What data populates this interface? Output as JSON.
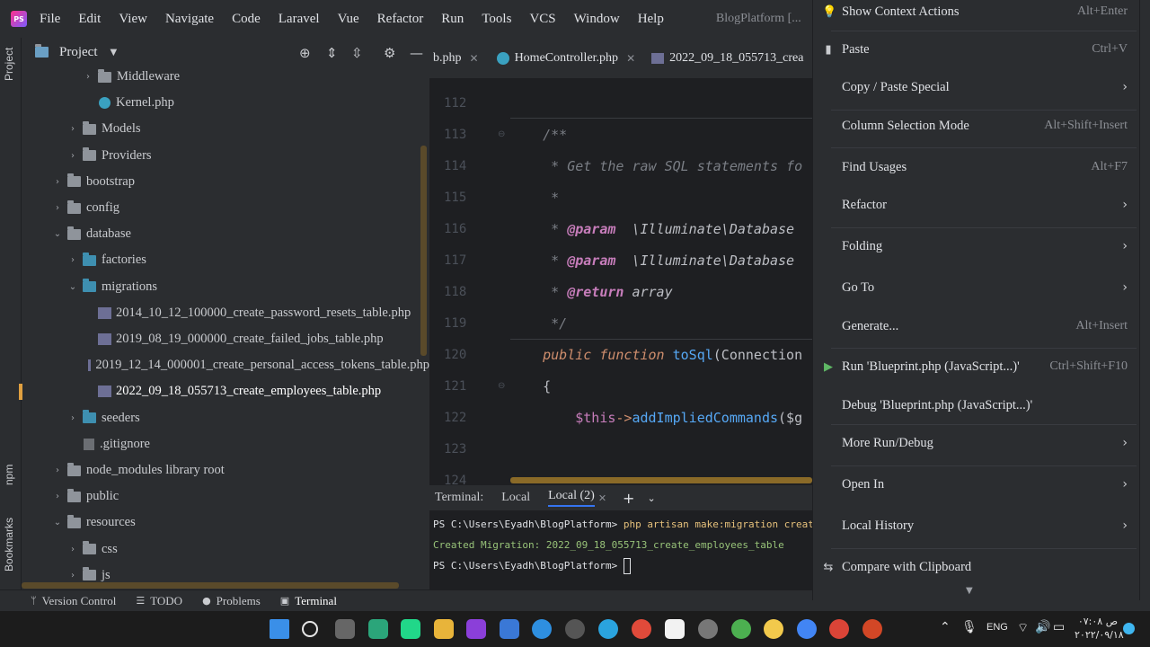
{
  "menubar": {
    "logo": "PS",
    "items": [
      "File",
      "Edit",
      "View",
      "Navigate",
      "Code",
      "Laravel",
      "Vue",
      "Refactor",
      "Run",
      "Tools",
      "VCS",
      "Window",
      "Help"
    ],
    "window_title": "BlogPlatform [..."
  },
  "left_strip": {
    "project": "Project",
    "npm": "npm",
    "bookmarks": "Bookmarks"
  },
  "project": {
    "title": "Project",
    "tree": [
      {
        "label": "Middleware",
        "depth": 3,
        "kind": "folder",
        "chevron": "›"
      },
      {
        "label": "Kernel.php",
        "depth": 3,
        "kind": "class"
      },
      {
        "label": "Models",
        "depth": 2,
        "kind": "folder",
        "chevron": "›"
      },
      {
        "label": "Providers",
        "depth": 2,
        "kind": "folder",
        "chevron": "›"
      },
      {
        "label": "bootstrap",
        "depth": 1,
        "kind": "folder",
        "chevron": "›"
      },
      {
        "label": "config",
        "depth": 1,
        "kind": "folder",
        "chevron": "›"
      },
      {
        "label": "database",
        "depth": 1,
        "kind": "folder",
        "chevron": "⌄"
      },
      {
        "label": "factories",
        "depth": 2,
        "kind": "folder-blue",
        "chevron": "›"
      },
      {
        "label": "migrations",
        "depth": 2,
        "kind": "folder-blue",
        "chevron": "⌄"
      },
      {
        "label": "2014_10_12_100000_create_password_resets_table.php",
        "depth": 3,
        "kind": "php"
      },
      {
        "label": "2019_08_19_000000_create_failed_jobs_table.php",
        "depth": 3,
        "kind": "php"
      },
      {
        "label": "2019_12_14_000001_create_personal_access_tokens_table.php",
        "depth": 3,
        "kind": "php"
      },
      {
        "label": "2022_09_18_055713_create_employees_table.php",
        "depth": 3,
        "kind": "php",
        "selected": true
      },
      {
        "label": "seeders",
        "depth": 2,
        "kind": "folder-blue",
        "chevron": "›"
      },
      {
        "label": ".gitignore",
        "depth": 2,
        "kind": "git"
      },
      {
        "label": "node_modules  library root",
        "depth": 1,
        "kind": "folder",
        "chevron": "›"
      },
      {
        "label": "public",
        "depth": 1,
        "kind": "folder",
        "chevron": "›"
      },
      {
        "label": "resources",
        "depth": 1,
        "kind": "folder",
        "chevron": "⌄"
      },
      {
        "label": "css",
        "depth": 2,
        "kind": "folder",
        "chevron": "›"
      },
      {
        "label": "js",
        "depth": 2,
        "kind": "folder",
        "chevron": "›"
      }
    ]
  },
  "editor": {
    "tabs": [
      {
        "label": "b.php",
        "icon": "none"
      },
      {
        "label": "HomeController.php",
        "icon": "class"
      },
      {
        "label": "2022_09_18_055713_crea",
        "icon": "php"
      }
    ],
    "lines": [
      {
        "n": "112",
        "tokens": []
      },
      {
        "n": "113",
        "tokens": [
          {
            "t": "    /**",
            "c": "cm"
          }
        ]
      },
      {
        "n": "114",
        "tokens": [
          {
            "t": "     * Get the raw SQL statements fo",
            "c": "cm"
          }
        ]
      },
      {
        "n": "115",
        "tokens": [
          {
            "t": "     *",
            "c": "cm"
          }
        ]
      },
      {
        "n": "116",
        "tokens": [
          {
            "t": "     * ",
            "c": "cm"
          },
          {
            "t": "@param",
            "c": "tag"
          },
          {
            "t": "  \\Illuminate\\Database",
            "c": "cm-plain"
          }
        ]
      },
      {
        "n": "117",
        "tokens": [
          {
            "t": "     * ",
            "c": "cm"
          },
          {
            "t": "@param",
            "c": "tag"
          },
          {
            "t": "  \\Illuminate\\Database",
            "c": "cm-plain"
          }
        ]
      },
      {
        "n": "118",
        "tokens": [
          {
            "t": "     * ",
            "c": "cm"
          },
          {
            "t": "@return",
            "c": "tag"
          },
          {
            "t": " array",
            "c": "cm-plain"
          }
        ]
      },
      {
        "n": "119",
        "tokens": [
          {
            "t": "     */",
            "c": "cm"
          }
        ]
      },
      {
        "n": "120",
        "tokens": [
          {
            "t": "    ",
            "c": "plain"
          },
          {
            "t": "public function",
            "c": "kw"
          },
          {
            "t": " ",
            "c": "plain"
          },
          {
            "t": "toSql",
            "c": "fn"
          },
          {
            "t": "(Connection",
            "c": "plain"
          }
        ]
      },
      {
        "n": "121",
        "tokens": [
          {
            "t": "    {",
            "c": "plain"
          }
        ]
      },
      {
        "n": "122",
        "tokens": [
          {
            "t": "        ",
            "c": "plain"
          },
          {
            "t": "$this",
            "c": "var"
          },
          {
            "t": "->",
            "c": "kw2"
          },
          {
            "t": "addImpliedCommands",
            "c": "fn"
          },
          {
            "t": "($g",
            "c": "plain"
          }
        ]
      },
      {
        "n": "123",
        "tokens": []
      },
      {
        "n": "124",
        "tokens": []
      }
    ]
  },
  "terminal": {
    "label": "Terminal:",
    "tabs": [
      "Local",
      "Local (2)"
    ],
    "prompt": "PS C:\\Users\\Eyadh\\BlogPlatform>",
    "command": " php artisan make:migration create_emplo",
    "output": "Created Migration: 2022_09_18_055713_create_employees_table",
    "prompt2": "PS C:\\Users\\Eyadh\\BlogPlatform> "
  },
  "context_menu": {
    "items": [
      {
        "label": "Show Context Actions",
        "shortcut": "Alt+Enter",
        "icon": "bulb",
        "submenu": false
      },
      {
        "label": "Paste",
        "shortcut": "Ctrl+V",
        "icon": "clipboard",
        "submenu": false
      },
      {
        "label": "Copy / Paste Special",
        "shortcut": "",
        "icon": "",
        "submenu": true
      },
      {
        "label": "Column Selection Mode",
        "shortcut": "Alt+Shift+Insert",
        "icon": "",
        "submenu": false
      },
      {
        "label": "Find Usages",
        "shortcut": "Alt+F7",
        "icon": "",
        "submenu": false
      },
      {
        "label": "Refactor",
        "shortcut": "",
        "icon": "",
        "submenu": true
      },
      {
        "label": "Folding",
        "shortcut": "",
        "icon": "",
        "submenu": true
      },
      {
        "label": "Go To",
        "shortcut": "",
        "icon": "",
        "submenu": true
      },
      {
        "label": "Generate...",
        "shortcut": "Alt+Insert",
        "icon": "",
        "submenu": false
      },
      {
        "label": "Run 'Blueprint.php (JavaScript...)'",
        "shortcut": "Ctrl+Shift+F10",
        "icon": "run",
        "submenu": false
      },
      {
        "label": "Debug 'Blueprint.php (JavaScript...)'",
        "shortcut": "",
        "icon": "debug",
        "submenu": false
      },
      {
        "label": "More Run/Debug",
        "shortcut": "",
        "icon": "",
        "submenu": true
      },
      {
        "label": "Open In",
        "shortcut": "",
        "icon": "",
        "submenu": true
      },
      {
        "label": "Local History",
        "shortcut": "",
        "icon": "",
        "submenu": true
      },
      {
        "label": "Compare with Clipboard",
        "shortcut": "",
        "icon": "compare",
        "submenu": false
      }
    ]
  },
  "statusbar": {
    "items": [
      {
        "icon": "branch",
        "label": "Version Control"
      },
      {
        "icon": "todo",
        "label": "TODO"
      },
      {
        "icon": "problems",
        "label": "Problems"
      },
      {
        "icon": "terminal",
        "label": "Terminal"
      }
    ]
  },
  "taskbar": {
    "language": "ENG",
    "time": "۰۷:۰۸ ص",
    "date": "۲۰۲۲/۰۹/۱۸"
  },
  "colors": {
    "accent": "#3574f0",
    "editor_bg": "#1e1f22",
    "panel_bg": "#2b2d30"
  }
}
